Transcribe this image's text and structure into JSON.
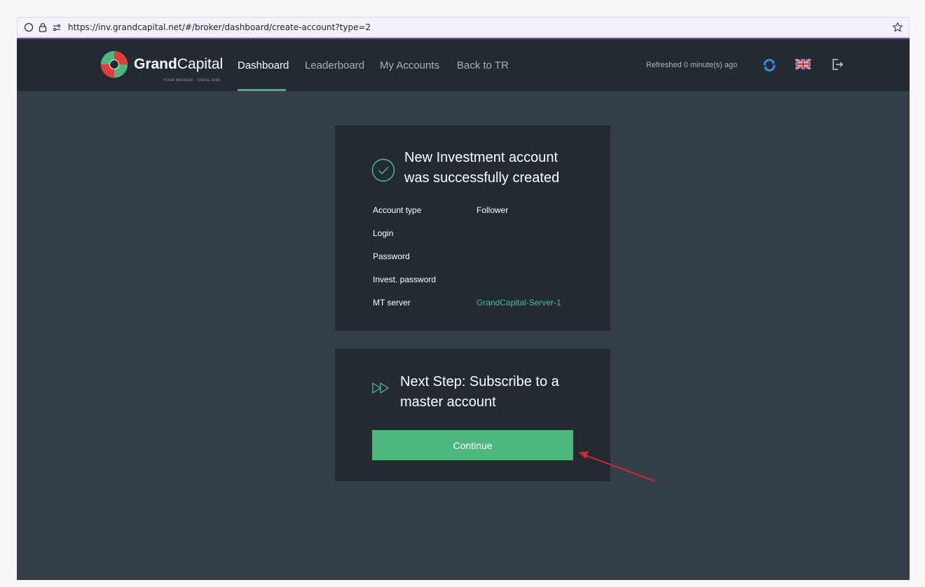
{
  "browser": {
    "url": "https://inv.grandcapital.net/#/broker/dashboard/create-account?type=2"
  },
  "nav": {
    "logo_bold": "Grand",
    "logo_light": "Capital",
    "logo_tagline": "YOUR BROKER · SINCE 2006",
    "items": [
      {
        "label": "Dashboard",
        "active": true
      },
      {
        "label": "Leaderboard",
        "active": false
      },
      {
        "label": "My Accounts",
        "active": false
      },
      {
        "label": "Back to TR",
        "active": false
      }
    ],
    "refreshed": "Refreshed 0 minute(s) ago",
    "language": "English (UK flag)"
  },
  "success_card": {
    "title_line1": "New Investment account",
    "title_line2": "was successfully created",
    "rows": [
      {
        "label": "Account type",
        "value": "Follower"
      },
      {
        "label": "Login",
        "value": ""
      },
      {
        "label": "Password",
        "value": ""
      },
      {
        "label": "Invest. password",
        "value": ""
      },
      {
        "label": "MT server",
        "value": "GrandCapital-Server-1"
      }
    ]
  },
  "next_card": {
    "title_line1": "Next Step: Subscribe to a",
    "title_line2": "master account",
    "button_label": "Continue"
  },
  "colors": {
    "accent": "#4cb87d",
    "nav_bg": "#232a31",
    "page_bg": "#353f49",
    "annotation_arrow": "#d9272e"
  }
}
